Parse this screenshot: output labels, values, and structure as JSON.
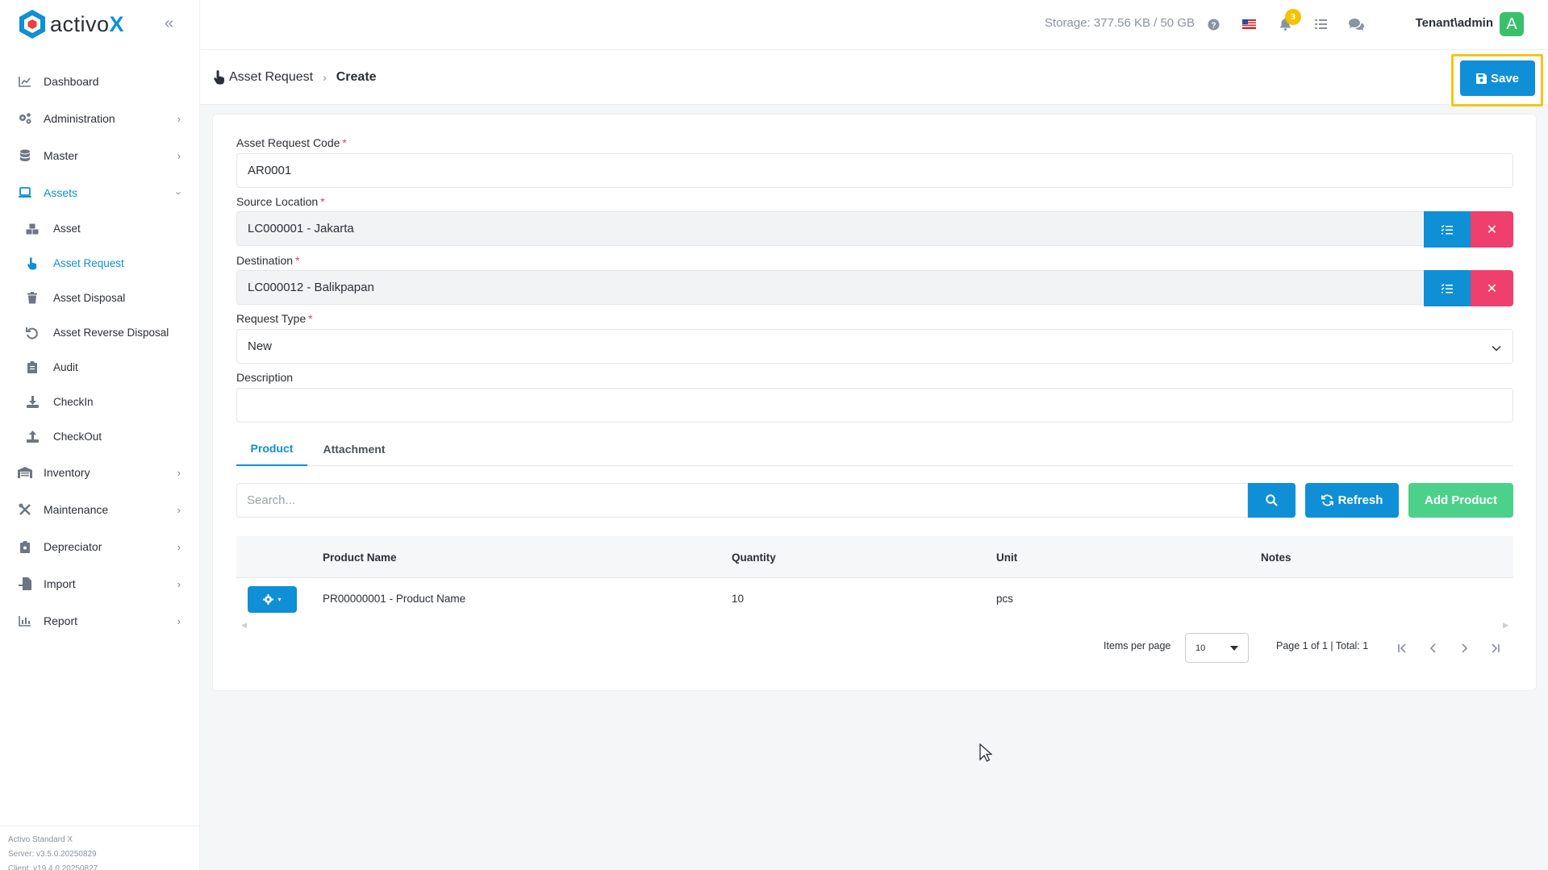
{
  "app": {
    "brand_name": "activo",
    "brand_suffix": "X"
  },
  "sidebar": {
    "items": [
      {
        "label": "Dashboard",
        "icon": "chart-line-icon"
      },
      {
        "label": "Administration",
        "icon": "gears-icon",
        "has_children": true
      },
      {
        "label": "Master",
        "icon": "database-icon",
        "has_children": true
      },
      {
        "label": "Assets",
        "icon": "laptop-icon",
        "has_children": true,
        "expanded": true,
        "active": true
      },
      {
        "label": "Inventory",
        "icon": "warehouse-icon",
        "has_children": true
      },
      {
        "label": "Maintenance",
        "icon": "tools-icon",
        "has_children": true
      },
      {
        "label": "Depreciator",
        "icon": "clipboard-icon",
        "has_children": true
      },
      {
        "label": "Import",
        "icon": "file-import-icon",
        "has_children": true
      },
      {
        "label": "Report",
        "icon": "chart-bar-icon",
        "has_children": true
      }
    ],
    "assets_children": [
      {
        "label": "Asset",
        "icon": "boxes-icon"
      },
      {
        "label": "Asset Request",
        "icon": "hand-pointer-icon",
        "active": true
      },
      {
        "label": "Asset Disposal",
        "icon": "trash-icon"
      },
      {
        "label": "Asset Reverse Disposal",
        "icon": "undo-icon"
      },
      {
        "label": "Audit",
        "icon": "clipboard-list-icon"
      },
      {
        "label": "CheckIn",
        "icon": "download-icon"
      },
      {
        "label": "CheckOut",
        "icon": "upload-icon"
      }
    ],
    "footer": {
      "product": "Activo Standard X",
      "server": "Server: v3.5.0.20250829",
      "client": "Client: v19.4.0.20250827"
    }
  },
  "topbar": {
    "storage": "Storage: 377.56 KB / 50 GB",
    "notification_count": "3",
    "tenant": "Tenant\\admin",
    "avatar_letter": "A"
  },
  "header": {
    "breadcrumb_parent": "Asset Request",
    "breadcrumb_current": "Create",
    "save_label": "Save"
  },
  "form": {
    "code_label": "Asset Request Code",
    "code_value": "AR0001",
    "source_label": "Source Location",
    "source_value": "LC000001 - Jakarta",
    "destination_label": "Destination",
    "destination_value": "LC000012 - Balikpapan",
    "request_type_label": "Request Type",
    "request_type_value": "New",
    "description_label": "Description",
    "description_value": "",
    "required_mark": "*"
  },
  "tabs": [
    {
      "label": "Product",
      "active": true
    },
    {
      "label": "Attachment",
      "active": false
    }
  ],
  "product_toolbar": {
    "search_placeholder": "Search...",
    "refresh_label": "Refresh",
    "add_label": "Add Product"
  },
  "table": {
    "columns": [
      "Product Name",
      "Quantity",
      "Unit",
      "Notes"
    ],
    "rows": [
      {
        "product_name": "PR00000001 - Product Name",
        "quantity": "10",
        "unit": "pcs",
        "notes": ""
      }
    ]
  },
  "paginator": {
    "items_per_page_label": "Items per page",
    "items_per_page_value": "10",
    "range_label": "Page 1 of 1 | Total: 1"
  },
  "colors": {
    "primary": "#0f8fd6",
    "danger": "#ef3f6c",
    "success": "#4cd18a",
    "highlight": "#f5c518",
    "badge": "#f6c200",
    "avatar": "#39c06b"
  }
}
